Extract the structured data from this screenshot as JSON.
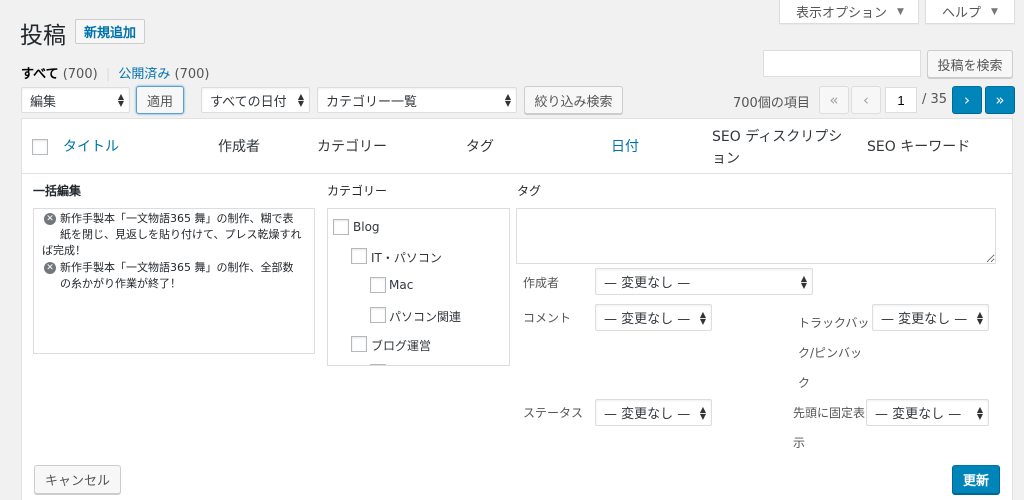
{
  "screen_options": "表示オプション",
  "help": "ヘルプ",
  "page_title": "投稿",
  "add_new": "新規追加",
  "filters": {
    "all_label": "すべて",
    "all_count": "(700)",
    "separator": "|",
    "published_label": "公開済み",
    "published_count": "(700)"
  },
  "search_button": "投稿を検索",
  "search_value": "",
  "bulk_action": "編集",
  "apply": "適用",
  "date_filter": "すべての日付",
  "category_filter": "カテゴリー一覧",
  "filter_button": "絞り込み検索",
  "pagination": {
    "items": "700個の項目",
    "first": "«",
    "prev": "‹",
    "current": "1",
    "total": "/ 35",
    "next": "›",
    "last": "»"
  },
  "columns": {
    "title": "タイトル",
    "author": "作成者",
    "categories": "カテゴリー",
    "tags": "タグ",
    "date": "日付",
    "seo_desc_1": "SEO ディスクリプシ",
    "seo_desc_2": "ョン",
    "seo_keyword": "SEO キーワード"
  },
  "bulk_edit": {
    "heading": "一括編集",
    "items": [
      {
        "lines": [
          "新作手製本「一文物語365 舞」の制作、糊で表",
          "紙を閉じ、見返しを貼り付けて、プレス乾燥すれ",
          "ば完成！"
        ]
      },
      {
        "lines": [
          "新作手製本「一文物語365 舞」の制作、全部数",
          "の糸かがり作業が終了！"
        ]
      }
    ],
    "category_heading": "カテゴリー",
    "categories": [
      "Blog",
      "IT・パソコン",
      "Mac",
      "パソコン関連",
      "ブログ運営"
    ],
    "tags_heading": "タグ",
    "tags_value": "",
    "author_label": "作成者",
    "author_value": "— 変更なし —",
    "comment_label": "コメント",
    "comment_value": "— 変更なし —",
    "trackback_label_1": "トラックバッ",
    "trackback_label_2": "ク/ピンバッ",
    "trackback_label_3": "ク",
    "trackback_value": "— 変更なし —",
    "status_label": "ステータス",
    "status_value": "— 変更なし —",
    "sticky_label_1": "先頭に固定表",
    "sticky_label_2": "示",
    "sticky_value": "— 変更なし —",
    "cancel": "キャンセル",
    "update": "更新"
  },
  "colors": {
    "link": "#0073aa",
    "primary": "#0085ba",
    "background": "#f1f1f1"
  }
}
